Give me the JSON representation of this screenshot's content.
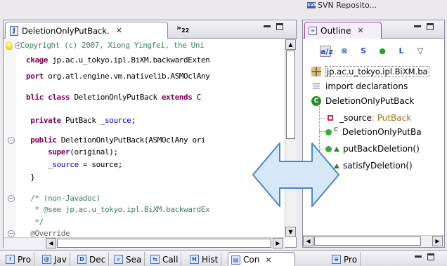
{
  "top": {
    "svn_tab": "SVN Reposito..."
  },
  "editor": {
    "tab_title": "DeletionOnlyPutBack.",
    "tab_close": "✕",
    "overflow": "»",
    "overflow_count": "22",
    "lines": [
      {
        "fold": "+",
        "parts": [
          {
            "t": "Copyright (c) 2007, Xiong Yingfei, the Uni",
            "c": "cm"
          }
        ]
      },
      {
        "parts": [
          {
            "t": "ckage ",
            "c": "kw"
          },
          {
            "t": "jp.ac.u_tokyo.ipl.BiXM.backwardExten",
            "c": ""
          }
        ]
      },
      {
        "parts": [
          {
            "t": "port ",
            "c": "kw"
          },
          {
            "t": "org.atl.engine.vm.nativelib.ASMOclAny",
            "c": ""
          }
        ]
      },
      {
        "parts": [
          {
            "t": "blic class ",
            "c": "kw"
          },
          {
            "t": "DeletionOnlyPutBack ",
            "c": ""
          },
          {
            "t": "extends",
            "c": "kw"
          },
          {
            "t": " C",
            "c": ""
          }
        ]
      },
      {
        "parts": [
          {
            "t": " private ",
            "c": "kw"
          },
          {
            "t": "PutBack ",
            "c": ""
          },
          {
            "t": "_source",
            "c": "fd"
          },
          {
            "t": ";",
            "c": ""
          }
        ]
      },
      {
        "fold": "−",
        "parts": [
          {
            "t": " public ",
            "c": "kw"
          },
          {
            "t": "DeletionOnlyPutBack(ASMOclAny ori",
            "c": ""
          }
        ]
      },
      {
        "parts": [
          {
            "t": "     super",
            "c": "kw"
          },
          {
            "t": "(original);",
            "c": ""
          }
        ]
      },
      {
        "parts": [
          {
            "t": "     ",
            "c": ""
          },
          {
            "t": "_source",
            "c": "fd"
          },
          {
            "t": " = source;",
            "c": ""
          }
        ]
      },
      {
        "parts": [
          {
            "t": " }",
            "c": ""
          }
        ]
      },
      {
        "fold": "−",
        "parts": [
          {
            "t": " /* (non-Javadoc)",
            "c": "cm"
          }
        ]
      },
      {
        "parts": [
          {
            "t": "  * @see jp.ac.u_tokyo.ipl.BiXM.backwardEx",
            "c": "cm"
          }
        ]
      },
      {
        "parts": [
          {
            "t": "  */",
            "c": "cm"
          }
        ]
      },
      {
        "fold": "−",
        "parts": [
          {
            "t": " @Override",
            "c": "an"
          }
        ]
      }
    ]
  },
  "outline": {
    "tab_title": "Outline",
    "tab_close": "✕",
    "toolbar": [
      "a/z",
      "⊗",
      "S",
      "●",
      "L",
      "▽"
    ],
    "items": [
      {
        "label": "jp.ac.u_tokyo.ipl.BiXM.ba",
        "kind": "package"
      },
      {
        "label": "import declarations",
        "kind": "imports"
      },
      {
        "label": "DeletionOnlyPutBack",
        "kind": "class"
      },
      {
        "label": "_source",
        "type": " : PutBack",
        "kind": "field"
      },
      {
        "label": "DeletionOnlyPutBa",
        "kind": "constructor"
      },
      {
        "label": "putBackDeletion()",
        "kind": "method"
      },
      {
        "label": "satisfyDeletion()",
        "kind": "method"
      }
    ]
  },
  "bottom_tabs": [
    {
      "label": "Pro"
    },
    {
      "label": "Jav"
    },
    {
      "label": "Dec"
    },
    {
      "label": "Sea"
    },
    {
      "label": "Call"
    },
    {
      "label": "Hist"
    },
    {
      "label": "Con"
    },
    {
      "label": "Pro"
    }
  ],
  "colors": {
    "keyword": "#7f0055",
    "comment": "#3f7f5f",
    "field": "#0000c0",
    "arrow_fill": "#d6e8f8",
    "arrow_stroke": "#4f85c8",
    "outline_active": "#a040b0"
  }
}
